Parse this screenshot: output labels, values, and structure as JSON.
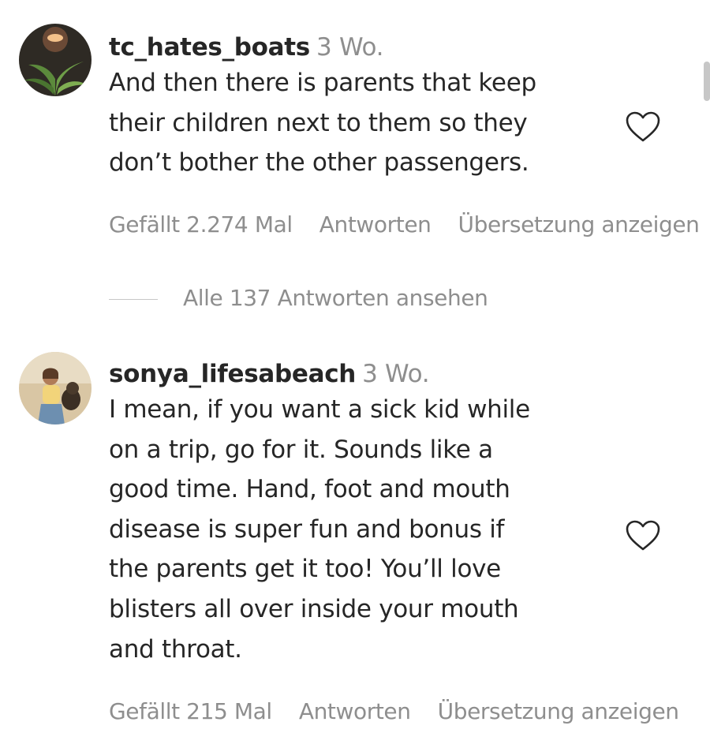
{
  "comments": [
    {
      "username": "tc_hates_boats",
      "time": "3 Wo.",
      "lines": [
        "And then there is parents that keep",
        "their children next to them so they",
        "don’t bother the other passengers."
      ],
      "likes_label": "Gefällt 2.274 Mal",
      "reply_label": "Antworten",
      "translate_label": "Übersetzung anzeigen",
      "heart_icon": "heart-outline-icon",
      "view_replies_label": "Alle 137 Antworten ansehen"
    },
    {
      "username": "sonya_lifesabeach",
      "time": "3 Wo.",
      "lines": [
        "I mean, if you want a sick kid while",
        "on a trip, go for it. Sounds like a",
        "good time. Hand, foot and mouth",
        "disease is super fun and bonus if",
        "the parents get it too! You’ll love",
        "blisters all over inside your mouth",
        "and throat."
      ],
      "likes_label": "Gefällt 215 Mal",
      "reply_label": "Antworten",
      "translate_label": "Übersetzung anzeigen",
      "heart_icon": "heart-outline-icon"
    }
  ],
  "colors": {
    "text": "#262626",
    "secondary": "#8e8e8e",
    "divider": "#c7c7c7",
    "background": "#ffffff"
  }
}
